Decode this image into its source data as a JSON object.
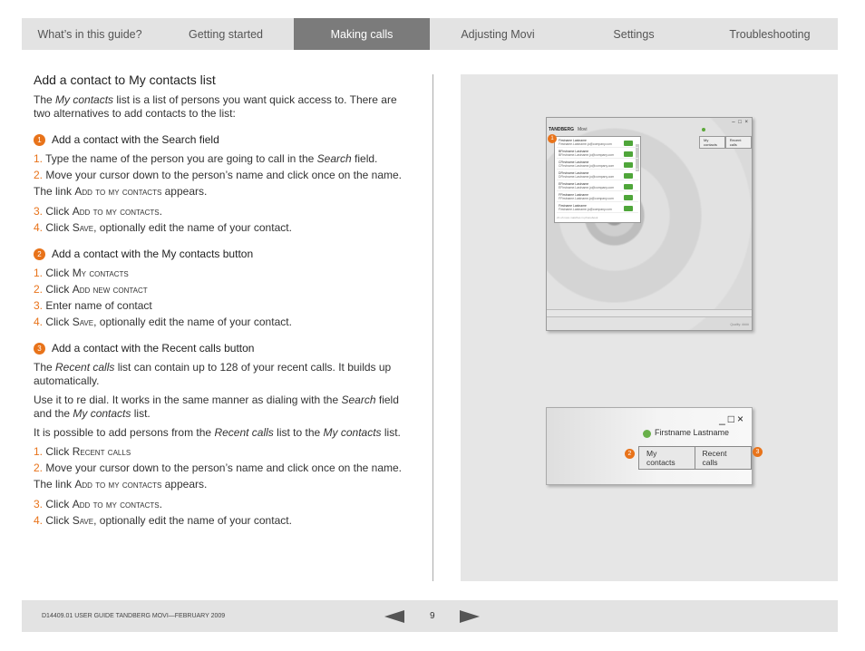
{
  "nav": {
    "tabs": [
      {
        "label": "What’s in this guide?"
      },
      {
        "label": "Getting started"
      },
      {
        "label": "Making calls"
      },
      {
        "label": "Adjusting Movi"
      },
      {
        "label": "Settings"
      },
      {
        "label": "Troubleshooting"
      }
    ],
    "active": "Making calls"
  },
  "content": {
    "title": "Add a contact to My contacts list",
    "intro": {
      "a": "The ",
      "em": "My contacts",
      "b": " list is a list of persons you want quick access to. There are two alternatives to add contacts to the list:"
    },
    "s1": {
      "badge": "1",
      "heading": "Add a contact with the Search field",
      "i1": {
        "n": "1.",
        "a": " Type the name of the person you are going to call in the ",
        "em": "Search",
        "b": " field."
      },
      "i2": {
        "n": "2.",
        "t": " Move your cursor down to the person’s name and click once on the name."
      },
      "link": {
        "a": "The link ",
        "sc": "Add to my contacts",
        "b": " appears."
      },
      "i3": {
        "n": "3.",
        "a": " Click ",
        "sc": "Add to my contacts",
        "b": "."
      },
      "i4": {
        "n": "4.",
        "a": " Click ",
        "sc": "Save",
        "b": ", optionally edit the name of your contact."
      }
    },
    "s2": {
      "badge": "2",
      "heading": "Add a contact with the My contacts button",
      "i1": {
        "n": "1.",
        "a": " Click ",
        "sc": "My contacts"
      },
      "i2": {
        "n": "2.",
        "a": " Click ",
        "sc": "Add new contact"
      },
      "i3": {
        "n": "3.",
        "t": " Enter name of contact"
      },
      "i4": {
        "n": "4.",
        "a": " Click ",
        "sc": "Save",
        "b": ", optionally edit the name of your contact."
      }
    },
    "s3": {
      "badge": "3",
      "heading": "Add a contact with the Recent calls button",
      "p1": {
        "a": "The ",
        "em": "Recent calls",
        "b": " list can contain up to 128 of your recent calls. It builds up automatically."
      },
      "p2": {
        "a": "Use it to re dial.  It works in the same manner as dialing with the ",
        "em1": "Search",
        "b": " field and the ",
        "em2": "My contacts",
        "c": " list."
      },
      "p3": {
        "a": "It is possible to add persons from the ",
        "em1": "Recent calls",
        "b": " list to the ",
        "em2": "My contacts",
        "c": " list."
      },
      "i1": {
        "n": "1.",
        "a": " Click ",
        "sc": "Recent calls"
      },
      "i2": {
        "n": "2.",
        "t": " Move your cursor down to the person’s name and click once on the name."
      },
      "link": {
        "a": "The link ",
        "sc": "Add to my contacts",
        "b": " appears."
      },
      "i3": {
        "n": "3.",
        "a": " Click ",
        "sc": "Add to my contacts",
        "b": "."
      },
      "i4": {
        "n": "4.",
        "a": " Click ",
        "sc": "Save",
        "b": ", optionally edit the name of your contact."
      }
    }
  },
  "screenshot1": {
    "brand": "TANDBERG",
    "app": "Movi",
    "winctl": "– □ ×",
    "tabs": [
      "My contacts",
      "Recent calls"
    ],
    "badge": "1",
    "rows": [
      {
        "t1": "Firstname Lastname",
        "t2": "Firstname.Lastname.jo@company.com"
      },
      {
        "t1": "BFirstname Lastname",
        "t2": "BFirstname.Lastname.jo@company.com"
      },
      {
        "t1": "CFirstname Lastname",
        "t2": "CFirstname.Lastname.jo@company.com"
      },
      {
        "t1": "DFirstname Lastname",
        "t2": "DFirstname.Lastname.jo@company.com"
      },
      {
        "t1": "EFirstname Lastname",
        "t2": "EFirstname.Lastname.jo@company.com"
      },
      {
        "t1": "FFirstname Lastname",
        "t2": "FFirstname.Lastname.jo@company.com"
      },
      {
        "t1": "Firstname Lastname",
        "t2": "Firstname.Lastname.jo@company.com"
      }
    ],
    "foot": "21 of more matches in phonebook",
    "status": "Quality: ####"
  },
  "screenshot2": {
    "winctl": "_□×",
    "name": "Firstname Lastname",
    "btn_my": "My contacts",
    "btn_recent": "Recent calls",
    "badge2": "2",
    "badge3": "3"
  },
  "footer": {
    "doc": "D14409.01 USER GUIDE TANDBERG MOVI—FEBRUARY 2009",
    "page": "9"
  }
}
